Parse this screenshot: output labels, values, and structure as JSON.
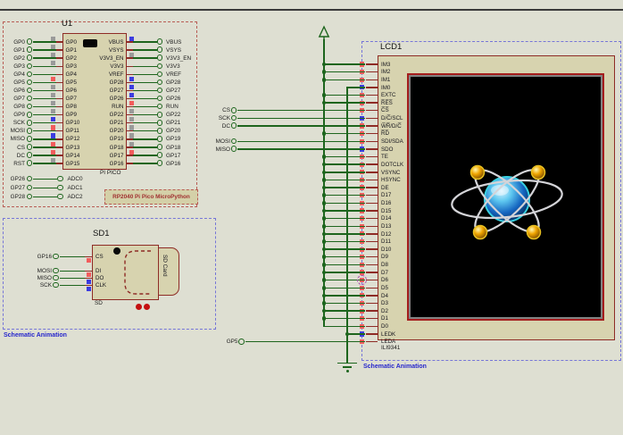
{
  "app": {
    "background": "#dedfd2",
    "top_border_color": "#3a3a3a"
  },
  "colors": {
    "wire": "#1d651d",
    "pin": "#8e2b25",
    "chip_fill": "#d7d3af",
    "state_red": "#f25c5c",
    "state_blue": "#3c3ce0",
    "state_gray": "#9a9a9a",
    "group_red": "#b85c54",
    "group_blue": "#7575d8",
    "annotation_blue": "#2525cc",
    "label_red": "#a03030",
    "screen_border": "#a51d1d",
    "screen_frame": "#828282",
    "screen_bg": "#000000"
  },
  "pico": {
    "ref": "U1",
    "value": "PI PICO",
    "group_label": "RP2040 Pi Pico MicroPython",
    "left_pins": [
      {
        "t": "GP0",
        "p": "GP0",
        "s": "gray"
      },
      {
        "t": "GP1",
        "p": "GP1",
        "s": "gray"
      },
      {
        "t": "GP2",
        "p": "GP2",
        "s": "gray"
      },
      {
        "t": "GP3",
        "p": "GP3",
        "s": "gray"
      },
      {
        "t": "GP4",
        "p": "GP4",
        "s": "none"
      },
      {
        "t": "GP5",
        "p": "GP5",
        "s": "red"
      },
      {
        "t": "GP6",
        "p": "GP6",
        "s": "gray"
      },
      {
        "t": "GP7",
        "p": "GP7",
        "s": "gray"
      },
      {
        "t": "GP8",
        "p": "GP8",
        "s": "gray"
      },
      {
        "t": "GP9",
        "p": "GP9",
        "s": "gray"
      },
      {
        "t": "SCK",
        "p": "GP10",
        "s": "blue"
      },
      {
        "t": "MOSI",
        "p": "GP11",
        "s": "red"
      },
      {
        "t": "MISO",
        "p": "GP12",
        "s": "blue"
      },
      {
        "t": "CS",
        "p": "GP13",
        "s": "red"
      },
      {
        "t": "DC",
        "p": "GP14",
        "s": "red"
      },
      {
        "t": "RST",
        "p": "GP15",
        "s": "gray"
      }
    ],
    "right_pins": [
      {
        "p": "VBUS",
        "t": "VBUS",
        "s": "blue"
      },
      {
        "p": "VSYS",
        "t": "VSYS",
        "s": "none"
      },
      {
        "p": "V3V3_EN",
        "t": "V3V3_EN",
        "s": "gray"
      },
      {
        "p": "V3V3",
        "t": "V3V3",
        "s": "none"
      },
      {
        "p": "VREF",
        "t": "VREF",
        "s": "none"
      },
      {
        "p": "GP28",
        "t": "GP28",
        "s": "blue"
      },
      {
        "p": "GP27",
        "t": "GP27",
        "s": "blue"
      },
      {
        "p": "GP26",
        "t": "GP26",
        "s": "blue"
      },
      {
        "p": "RUN",
        "t": "RUN",
        "s": "red"
      },
      {
        "p": "GP22",
        "t": "GP22",
        "s": "gray"
      },
      {
        "p": "GP21",
        "t": "GP21",
        "s": "gray"
      },
      {
        "p": "GP20",
        "t": "GP20",
        "s": "gray"
      },
      {
        "p": "GP19",
        "t": "GP19",
        "s": "gray"
      },
      {
        "p": "GP18",
        "t": "GP18",
        "s": "gray"
      },
      {
        "p": "GP17",
        "t": "GP17",
        "s": "red"
      },
      {
        "p": "GP16",
        "t": "GP16",
        "s": "none"
      }
    ],
    "adc_links": [
      {
        "l": "GP26",
        "r": "ADC0"
      },
      {
        "l": "GP27",
        "r": "ADC1"
      },
      {
        "l": "GP28",
        "r": "ADC2"
      }
    ]
  },
  "lcd": {
    "ref": "LCD1",
    "value": "ILI9341",
    "group_label": "Schematic Animation",
    "pins": [
      {
        "n": "IM3",
        "s": "red",
        "w": "rail1"
      },
      {
        "n": "IM2",
        "s": "red",
        "w": "rail1"
      },
      {
        "n": "IM1",
        "s": "red",
        "w": "rail1"
      },
      {
        "n": "IM0",
        "s": "blue",
        "w": "rail2start"
      },
      {
        "n": "EXTC",
        "s": "red",
        "w": "rail1"
      },
      {
        "n": "R̅E̅S̅",
        "s": "red",
        "w": "rail1"
      },
      {
        "n": "C̅S̅",
        "s": "red",
        "w": "term",
        "term": "CS"
      },
      {
        "n": "D/C̅/SCL",
        "s": "blue",
        "w": "term",
        "term": "SCK"
      },
      {
        "n": "W̅R̅/D/C̅",
        "s": "red",
        "w": "term",
        "term": "DC"
      },
      {
        "n": "R̅D̅",
        "s": "red",
        "w": "rail1"
      },
      {
        "n": "SDI/SDA",
        "s": "red",
        "w": "term",
        "term": "MOSI"
      },
      {
        "n": "SDO",
        "s": "blue",
        "w": "term",
        "term": "MISO"
      },
      {
        "n": "TE",
        "s": "red",
        "w": "rail1"
      },
      {
        "n": "DOTCLK",
        "s": "red",
        "w": "rail1"
      },
      {
        "n": "VSYNC",
        "s": "red",
        "w": "rail1"
      },
      {
        "n": "HSYNC",
        "s": "red",
        "w": "rail1"
      },
      {
        "n": "DE",
        "s": "red",
        "w": "rail1"
      },
      {
        "n": "D17",
        "s": "red",
        "w": "rail1"
      },
      {
        "n": "D16",
        "s": "red",
        "w": "rail1"
      },
      {
        "n": "D15",
        "s": "red",
        "w": "rail1"
      },
      {
        "n": "D14",
        "s": "red",
        "w": "rail1"
      },
      {
        "n": "D13",
        "s": "red",
        "w": "rail1"
      },
      {
        "n": "D12",
        "s": "red",
        "w": "rail1"
      },
      {
        "n": "D11",
        "s": "red",
        "w": "rail1"
      },
      {
        "n": "D10",
        "s": "red",
        "w": "rail1"
      },
      {
        "n": "D9",
        "s": "red",
        "w": "rail1"
      },
      {
        "n": "D8",
        "s": "red",
        "w": "rail1"
      },
      {
        "n": "D7",
        "s": "red",
        "w": "rail1"
      },
      {
        "n": "D6",
        "s": "red",
        "w": "rail1",
        "marker": true
      },
      {
        "n": "D5",
        "s": "red",
        "w": "rail1"
      },
      {
        "n": "D4",
        "s": "red",
        "w": "rail1"
      },
      {
        "n": "D3",
        "s": "red",
        "w": "rail1"
      },
      {
        "n": "D2",
        "s": "red",
        "w": "rail1"
      },
      {
        "n": "D1",
        "s": "red",
        "w": "rail1"
      },
      {
        "n": "D0",
        "s": "red",
        "w": "rail1end"
      },
      {
        "n": "LEDK",
        "s": "blue",
        "w": "rail2dot"
      },
      {
        "n": "LEDA",
        "s": "red",
        "w": "term",
        "term": "GP5"
      }
    ]
  },
  "sd": {
    "ref": "SD1",
    "value": "SD",
    "card_label": "SD Card",
    "group_label": "Schematic Animation",
    "pins": [
      {
        "t": "GP16",
        "n": "CS",
        "s": "red"
      },
      {
        "t": "MOSI",
        "n": "DI",
        "s": "red"
      },
      {
        "t": "MISO",
        "n": "DO",
        "s": "blue"
      },
      {
        "t": "SCK",
        "n": "CLK",
        "s": "blue"
      }
    ]
  }
}
